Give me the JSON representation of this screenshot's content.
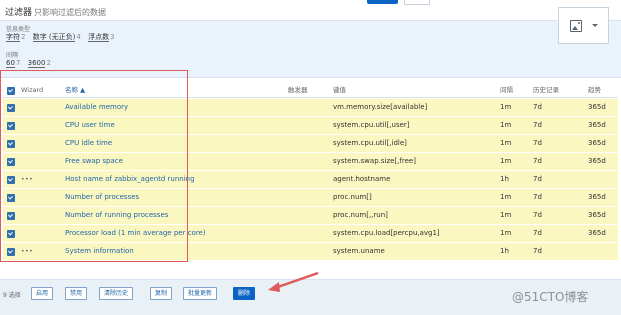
{
  "filter": {
    "title": "过滤器",
    "subtitle": "只影响过滤后的数据",
    "info_type_label": "信息类型",
    "info_types": [
      {
        "label": "字符",
        "count": "2"
      },
      {
        "label": "数字 (无正负)",
        "count": "4"
      },
      {
        "label": "浮点数",
        "count": "3"
      }
    ],
    "interval_label": "间隔",
    "intervals": [
      {
        "label": "60",
        "count": "7"
      },
      {
        "label": "3600",
        "count": "2"
      }
    ]
  },
  "media_icon": "image-icon",
  "table": {
    "columns": {
      "wizard": "Wizard",
      "name": "名称 ▲",
      "triggers": "触发器",
      "key": "键值",
      "interval": "间隔",
      "history": "历史记录",
      "trends": "趋势"
    },
    "rows": [
      {
        "wizard": "",
        "name": "Available memory",
        "key": "vm.memory.size[available]",
        "interval": "1m",
        "history": "7d",
        "trends": "365d"
      },
      {
        "wizard": "",
        "name": "CPU user time",
        "key": "system.cpu.util[,user]",
        "interval": "1m",
        "history": "7d",
        "trends": "365d"
      },
      {
        "wizard": "",
        "name": "CPU idle time",
        "key": "system.cpu.util[,idle]",
        "interval": "1m",
        "history": "7d",
        "trends": "365d"
      },
      {
        "wizard": "",
        "name": "Free swap space",
        "key": "system.swap.size[,free]",
        "interval": "1m",
        "history": "7d",
        "trends": "365d"
      },
      {
        "wizard": "•••",
        "name": "Host name of zabbix_agentd running",
        "key": "agent.hostname",
        "interval": "1h",
        "history": "7d",
        "trends": ""
      },
      {
        "wizard": "",
        "name": "Number of processes",
        "key": "proc.num[]",
        "interval": "1m",
        "history": "7d",
        "trends": "365d"
      },
      {
        "wizard": "",
        "name": "Number of running processes",
        "key": "proc.num[,,run]",
        "interval": "1m",
        "history": "7d",
        "trends": "365d"
      },
      {
        "wizard": "",
        "name": "Processor load (1 min average per core)",
        "key": "system.cpu.load[percpu,avg1]",
        "interval": "1m",
        "history": "7d",
        "trends": "365d"
      },
      {
        "wizard": "•••",
        "name": "System information",
        "key": "system.uname",
        "interval": "1h",
        "history": "7d",
        "trends": ""
      }
    ]
  },
  "footer": {
    "selected": "9 选择",
    "buttons": [
      "启用",
      "禁用",
      "清除历史",
      "复制",
      "批量更新",
      "删除"
    ]
  },
  "watermark": "@51CTO博客",
  "colors": {
    "row_highlight": "#fbf7c1",
    "link": "#1f65a6",
    "primary": "#0b63c4",
    "annotation": "#e0585a"
  }
}
